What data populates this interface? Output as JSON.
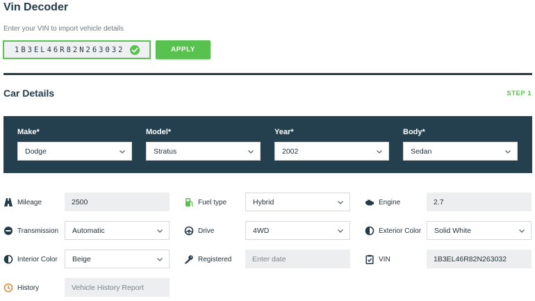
{
  "vin_decoder": {
    "title": "Vin Decoder",
    "subtitle": "Enter your VIN to import vehicle details",
    "vin_value": "1B3EL46R82N263032",
    "apply_label": "APPLY"
  },
  "car_details": {
    "title": "Car Details",
    "step": "STEP 1"
  },
  "primary_fields": [
    {
      "label": "Make*",
      "value": "Dodge"
    },
    {
      "label": "Model*",
      "value": "Stratus"
    },
    {
      "label": "Year*",
      "value": "2002"
    },
    {
      "label": "Body*",
      "value": "Sedan"
    }
  ],
  "detail_fields": {
    "mileage": {
      "label": "Mileage",
      "value": "2500",
      "icon": "road-icon"
    },
    "fuel_type": {
      "label": "Fuel type",
      "value": "Hybrid",
      "icon": "fuel-pump-icon"
    },
    "engine": {
      "label": "Engine",
      "value": "2.7",
      "icon": "engine-icon"
    },
    "transmission": {
      "label": "Transmission",
      "value": "Automatic",
      "icon": "transmission-icon"
    },
    "drive": {
      "label": "Drive",
      "value": "4WD",
      "icon": "steering-wheel-icon"
    },
    "exterior_color": {
      "label": "Exterior Color",
      "value": "Solid White",
      "icon": "half-circle-icon"
    },
    "interior_color": {
      "label": "Interior Color",
      "value": "Beige",
      "icon": "half-circle-icon"
    },
    "registered": {
      "label": "Registered",
      "placeholder": "Enter date",
      "icon": "key-icon"
    },
    "vin": {
      "label": "VIN",
      "value": "1B3EL46R82N263032",
      "icon": "clipboard-check-icon"
    },
    "history": {
      "label": "History",
      "placeholder": "Vehicle History Report",
      "icon": "clock-icon"
    }
  },
  "colors": {
    "accent_green": "#58c14f",
    "navy": "#233a48",
    "panel": "#24404f",
    "history_icon": "#d6893a"
  }
}
